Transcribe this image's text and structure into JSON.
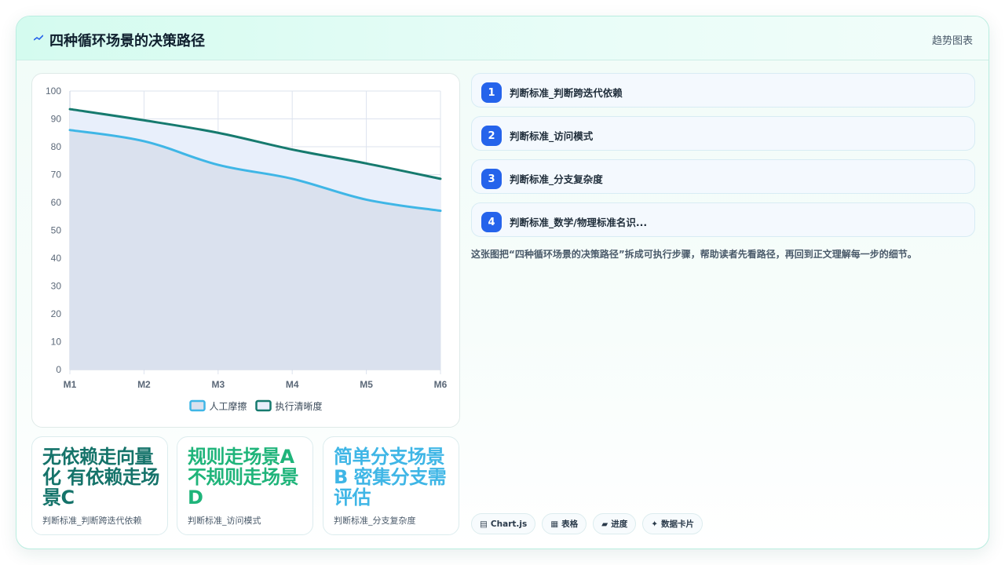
{
  "header": {
    "title": "四种循环场景的决策路径",
    "badge": "趋势图表"
  },
  "chart_data": {
    "type": "line",
    "categories": [
      "M1",
      "M2",
      "M3",
      "M4",
      "M5",
      "M6"
    ],
    "ylim": [
      0,
      100
    ],
    "yticks": [
      0,
      10,
      20,
      30,
      40,
      50,
      60,
      70,
      80,
      90,
      100
    ],
    "grid": true,
    "legend_position": "bottom",
    "area_fill": true,
    "series": [
      {
        "name": "人工摩擦",
        "values": [
          86,
          82,
          73.5,
          68.5,
          61,
          57
        ],
        "color": "#3fb6e6",
        "fill": "#dae1ee"
      },
      {
        "name": "执行清晰度",
        "values": [
          93.5,
          89.5,
          85,
          79,
          74,
          68.5
        ],
        "color": "#167a6e",
        "fill": "#e8effb"
      }
    ]
  },
  "steps": [
    {
      "num": "1",
      "label": "判断标准_判断跨迭代依赖"
    },
    {
      "num": "2",
      "label": "判断标准_访问模式"
    },
    {
      "num": "3",
      "label": "判断标准_分支复杂度"
    },
    {
      "num": "4",
      "label": "判断标准_数学/物理标准名识..."
    }
  ],
  "description": "这张图把“四种循环场景的决策路径”拆成可执行步骤，帮助读者先看路径，再回到正文理解每一步的细节。",
  "metrics": [
    {
      "value": "无依赖走向量化 有依赖走场景C",
      "label": "判断标准_判断跨迭代依赖",
      "color": "#15736a"
    },
    {
      "value": "规则走场景A 不规则走场景D",
      "label": "判断标准_访问模式",
      "color": "#1fb47a"
    },
    {
      "value": "简单分支场景B 密集分支需评估",
      "label": "判断标准_分支复杂度",
      "color": "#3fb6e6"
    }
  ],
  "tags": [
    {
      "icon": "▤",
      "label": "Chart.js"
    },
    {
      "icon": "▦",
      "label": "表格"
    },
    {
      "icon": "▰",
      "label": "进度"
    },
    {
      "icon": "✦",
      "label": "数据卡片"
    }
  ]
}
